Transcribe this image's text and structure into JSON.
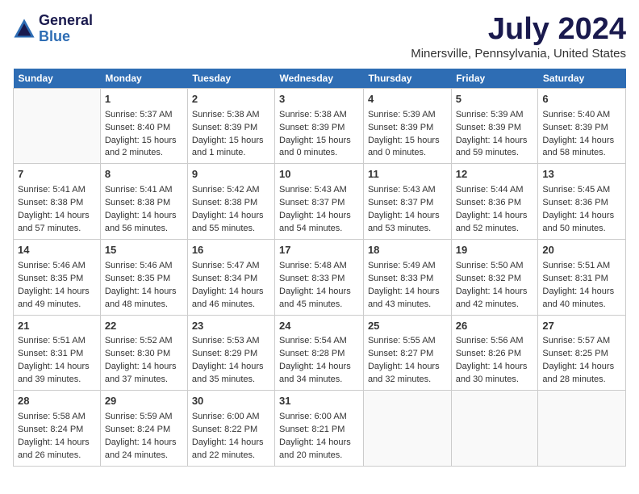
{
  "header": {
    "logo_general": "General",
    "logo_blue": "Blue",
    "month_year": "July 2024",
    "location": "Minersville, Pennsylvania, United States"
  },
  "days_of_week": [
    "Sunday",
    "Monday",
    "Tuesday",
    "Wednesday",
    "Thursday",
    "Friday",
    "Saturday"
  ],
  "weeks": [
    [
      {
        "day": "",
        "sunrise": "",
        "sunset": "",
        "daylight": ""
      },
      {
        "day": "1",
        "sunrise": "Sunrise: 5:37 AM",
        "sunset": "Sunset: 8:40 PM",
        "daylight": "Daylight: 15 hours and 2 minutes."
      },
      {
        "day": "2",
        "sunrise": "Sunrise: 5:38 AM",
        "sunset": "Sunset: 8:39 PM",
        "daylight": "Daylight: 15 hours and 1 minute."
      },
      {
        "day": "3",
        "sunrise": "Sunrise: 5:38 AM",
        "sunset": "Sunset: 8:39 PM",
        "daylight": "Daylight: 15 hours and 0 minutes."
      },
      {
        "day": "4",
        "sunrise": "Sunrise: 5:39 AM",
        "sunset": "Sunset: 8:39 PM",
        "daylight": "Daylight: 15 hours and 0 minutes."
      },
      {
        "day": "5",
        "sunrise": "Sunrise: 5:39 AM",
        "sunset": "Sunset: 8:39 PM",
        "daylight": "Daylight: 14 hours and 59 minutes."
      },
      {
        "day": "6",
        "sunrise": "Sunrise: 5:40 AM",
        "sunset": "Sunset: 8:39 PM",
        "daylight": "Daylight: 14 hours and 58 minutes."
      }
    ],
    [
      {
        "day": "7",
        "sunrise": "Sunrise: 5:41 AM",
        "sunset": "Sunset: 8:38 PM",
        "daylight": "Daylight: 14 hours and 57 minutes."
      },
      {
        "day": "8",
        "sunrise": "Sunrise: 5:41 AM",
        "sunset": "Sunset: 8:38 PM",
        "daylight": "Daylight: 14 hours and 56 minutes."
      },
      {
        "day": "9",
        "sunrise": "Sunrise: 5:42 AM",
        "sunset": "Sunset: 8:38 PM",
        "daylight": "Daylight: 14 hours and 55 minutes."
      },
      {
        "day": "10",
        "sunrise": "Sunrise: 5:43 AM",
        "sunset": "Sunset: 8:37 PM",
        "daylight": "Daylight: 14 hours and 54 minutes."
      },
      {
        "day": "11",
        "sunrise": "Sunrise: 5:43 AM",
        "sunset": "Sunset: 8:37 PM",
        "daylight": "Daylight: 14 hours and 53 minutes."
      },
      {
        "day": "12",
        "sunrise": "Sunrise: 5:44 AM",
        "sunset": "Sunset: 8:36 PM",
        "daylight": "Daylight: 14 hours and 52 minutes."
      },
      {
        "day": "13",
        "sunrise": "Sunrise: 5:45 AM",
        "sunset": "Sunset: 8:36 PM",
        "daylight": "Daylight: 14 hours and 50 minutes."
      }
    ],
    [
      {
        "day": "14",
        "sunrise": "Sunrise: 5:46 AM",
        "sunset": "Sunset: 8:35 PM",
        "daylight": "Daylight: 14 hours and 49 minutes."
      },
      {
        "day": "15",
        "sunrise": "Sunrise: 5:46 AM",
        "sunset": "Sunset: 8:35 PM",
        "daylight": "Daylight: 14 hours and 48 minutes."
      },
      {
        "day": "16",
        "sunrise": "Sunrise: 5:47 AM",
        "sunset": "Sunset: 8:34 PM",
        "daylight": "Daylight: 14 hours and 46 minutes."
      },
      {
        "day": "17",
        "sunrise": "Sunrise: 5:48 AM",
        "sunset": "Sunset: 8:33 PM",
        "daylight": "Daylight: 14 hours and 45 minutes."
      },
      {
        "day": "18",
        "sunrise": "Sunrise: 5:49 AM",
        "sunset": "Sunset: 8:33 PM",
        "daylight": "Daylight: 14 hours and 43 minutes."
      },
      {
        "day": "19",
        "sunrise": "Sunrise: 5:50 AM",
        "sunset": "Sunset: 8:32 PM",
        "daylight": "Daylight: 14 hours and 42 minutes."
      },
      {
        "day": "20",
        "sunrise": "Sunrise: 5:51 AM",
        "sunset": "Sunset: 8:31 PM",
        "daylight": "Daylight: 14 hours and 40 minutes."
      }
    ],
    [
      {
        "day": "21",
        "sunrise": "Sunrise: 5:51 AM",
        "sunset": "Sunset: 8:31 PM",
        "daylight": "Daylight: 14 hours and 39 minutes."
      },
      {
        "day": "22",
        "sunrise": "Sunrise: 5:52 AM",
        "sunset": "Sunset: 8:30 PM",
        "daylight": "Daylight: 14 hours and 37 minutes."
      },
      {
        "day": "23",
        "sunrise": "Sunrise: 5:53 AM",
        "sunset": "Sunset: 8:29 PM",
        "daylight": "Daylight: 14 hours and 35 minutes."
      },
      {
        "day": "24",
        "sunrise": "Sunrise: 5:54 AM",
        "sunset": "Sunset: 8:28 PM",
        "daylight": "Daylight: 14 hours and 34 minutes."
      },
      {
        "day": "25",
        "sunrise": "Sunrise: 5:55 AM",
        "sunset": "Sunset: 8:27 PM",
        "daylight": "Daylight: 14 hours and 32 minutes."
      },
      {
        "day": "26",
        "sunrise": "Sunrise: 5:56 AM",
        "sunset": "Sunset: 8:26 PM",
        "daylight": "Daylight: 14 hours and 30 minutes."
      },
      {
        "day": "27",
        "sunrise": "Sunrise: 5:57 AM",
        "sunset": "Sunset: 8:25 PM",
        "daylight": "Daylight: 14 hours and 28 minutes."
      }
    ],
    [
      {
        "day": "28",
        "sunrise": "Sunrise: 5:58 AM",
        "sunset": "Sunset: 8:24 PM",
        "daylight": "Daylight: 14 hours and 26 minutes."
      },
      {
        "day": "29",
        "sunrise": "Sunrise: 5:59 AM",
        "sunset": "Sunset: 8:24 PM",
        "daylight": "Daylight: 14 hours and 24 minutes."
      },
      {
        "day": "30",
        "sunrise": "Sunrise: 6:00 AM",
        "sunset": "Sunset: 8:22 PM",
        "daylight": "Daylight: 14 hours and 22 minutes."
      },
      {
        "day": "31",
        "sunrise": "Sunrise: 6:00 AM",
        "sunset": "Sunset: 8:21 PM",
        "daylight": "Daylight: 14 hours and 20 minutes."
      },
      {
        "day": "",
        "sunrise": "",
        "sunset": "",
        "daylight": ""
      },
      {
        "day": "",
        "sunrise": "",
        "sunset": "",
        "daylight": ""
      },
      {
        "day": "",
        "sunrise": "",
        "sunset": "",
        "daylight": ""
      }
    ]
  ]
}
